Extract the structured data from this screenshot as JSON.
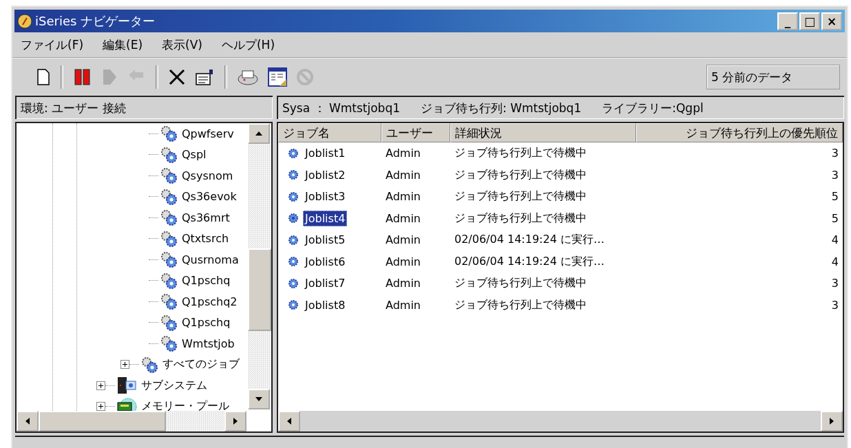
{
  "window": {
    "title": "iSeries ナビゲーター",
    "controls": [
      "_",
      "□",
      "×"
    ]
  },
  "menu": [
    "ファイル(F)",
    "編集(E)",
    "表示(V)",
    "ヘルプ(H)"
  ],
  "toolbar": {
    "buttons": [
      {
        "kind": "new",
        "disabled": false
      },
      {
        "kind": "sep"
      },
      {
        "kind": "hold",
        "disabled": false
      },
      {
        "kind": "release",
        "disabled": true
      },
      {
        "kind": "reply",
        "disabled": true
      },
      {
        "kind": "sep"
      },
      {
        "kind": "delete",
        "disabled": false
      },
      {
        "kind": "properties",
        "disabled": false
      },
      {
        "kind": "sep"
      },
      {
        "kind": "print",
        "disabled": false
      },
      {
        "kind": "columns",
        "disabled": false
      },
      {
        "kind": "stop",
        "disabled": true
      }
    ],
    "data_age": "5 分前のデータ"
  },
  "left_header": "環境: ユーザー 接続",
  "right_header": [
    "Sysa ： Wmtstjobq1",
    "ジョブ待ち行列: Wmtstjobq1",
    "ライブラリー:Qgpl"
  ],
  "tree": {
    "nodes": [
      {
        "children": [
          {
            "children": [
              {
                "label": "Qpwfserv",
                "kind": "queue"
              },
              {
                "label": "Qspl",
                "kind": "queue"
              },
              {
                "label": "Qsysnom",
                "kind": "queue"
              },
              {
                "label": "Qs36evok",
                "kind": "queue"
              },
              {
                "label": "Qs36mrt",
                "kind": "queue"
              },
              {
                "label": "Qtxtsrch",
                "kind": "queue"
              },
              {
                "label": "Qusrnoma",
                "kind": "queue"
              },
              {
                "label": "Q1pschq",
                "kind": "queue"
              },
              {
                "label": "Q1pschq2",
                "kind": "queue"
              },
              {
                "label": "Q1pschq",
                "kind": "queue"
              },
              {
                "label": "Wmtstjob",
                "kind": "queue"
              }
            ]
          },
          {
            "label": "すべてのジョブ",
            "kind": "queue",
            "expanded": false
          }
        ]
      },
      {
        "label": "サブシステム",
        "kind": "subsystem",
        "expanded": false
      },
      {
        "label": "メモリー・プール",
        "kind": "memory",
        "expanded": false
      }
    ]
  },
  "table": {
    "columns": [
      "ジョブ名",
      "ユーザー",
      "詳細状況",
      "ジョブ待ち行列上の優先順位"
    ],
    "rows": [
      {
        "name": "Joblist1",
        "user": "Admin",
        "status": "ジョブ待ち行列上で待機中",
        "priority": "3",
        "selected": false
      },
      {
        "name": "Joblist2",
        "user": "Admin",
        "status": "ジョブ待ち行列上で待機中",
        "priority": "3",
        "selected": false
      },
      {
        "name": "Joblist3",
        "user": "Admin",
        "status": "ジョブ待ち行列上で待機中",
        "priority": "5",
        "selected": false
      },
      {
        "name": "Joblist4",
        "user": "Admin",
        "status": "ジョブ待ち行列上で待機中",
        "priority": "5",
        "selected": true
      },
      {
        "name": "Joblist5",
        "user": "Admin",
        "status": "02/06/04 14:19:24 に実行…",
        "priority": "4",
        "selected": false
      },
      {
        "name": "Joblist6",
        "user": "Admin",
        "status": "02/06/04 14:19:24 に実行…",
        "priority": "4",
        "selected": false
      },
      {
        "name": "Joblist7",
        "user": "Admin",
        "status": "ジョブ待ち行列上で待機中",
        "priority": "3",
        "selected": false
      },
      {
        "name": "Joblist8",
        "user": "Admin",
        "status": "ジョブ待ち行列上で待機中",
        "priority": "3",
        "selected": false
      }
    ]
  }
}
